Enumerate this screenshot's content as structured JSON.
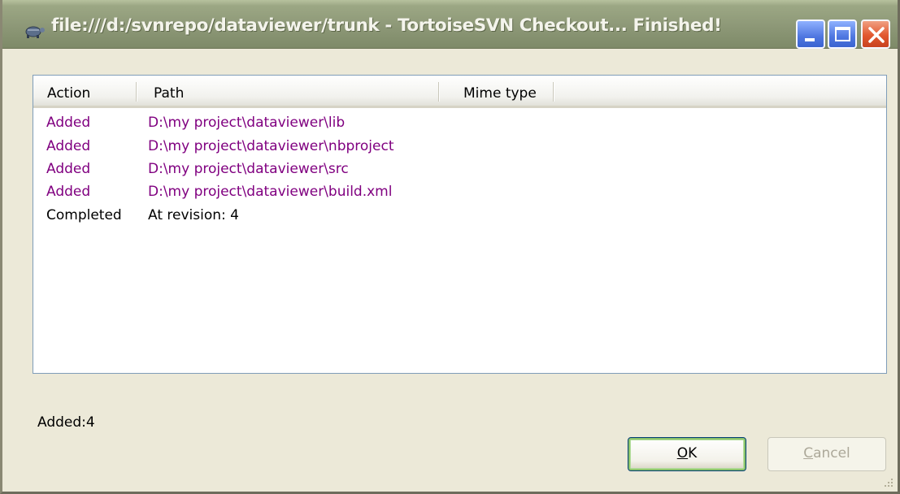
{
  "window": {
    "title": "file:///d:/svnrepo/dataviewer/trunk - TortoiseSVN Checkout... Finished!"
  },
  "list": {
    "columns": [
      "Action",
      "Path",
      "Mime type"
    ],
    "rows": [
      {
        "action": "Added",
        "path": "D:\\my project\\dataviewer\\lib",
        "kind": "added"
      },
      {
        "action": "Added",
        "path": "D:\\my project\\dataviewer\\nbproject",
        "kind": "added"
      },
      {
        "action": "Added",
        "path": "D:\\my project\\dataviewer\\src",
        "kind": "added"
      },
      {
        "action": "Added",
        "path": "D:\\my project\\dataviewer\\build.xml",
        "kind": "added"
      },
      {
        "action": "Completed",
        "path": "At revision: 4",
        "kind": "done"
      }
    ]
  },
  "status": {
    "summary": "Added:4"
  },
  "buttons": {
    "ok_accel": "O",
    "ok_rest": "K",
    "cancel_accel": "C",
    "cancel_rest": "ancel"
  },
  "colors": {
    "added": "#800080",
    "completed": "#000000",
    "ok_focus": "#8cc46b"
  },
  "icons": [
    "tortoise-icon",
    "minimize-icon",
    "maximize-icon",
    "close-icon",
    "resize-grip-icon"
  ]
}
